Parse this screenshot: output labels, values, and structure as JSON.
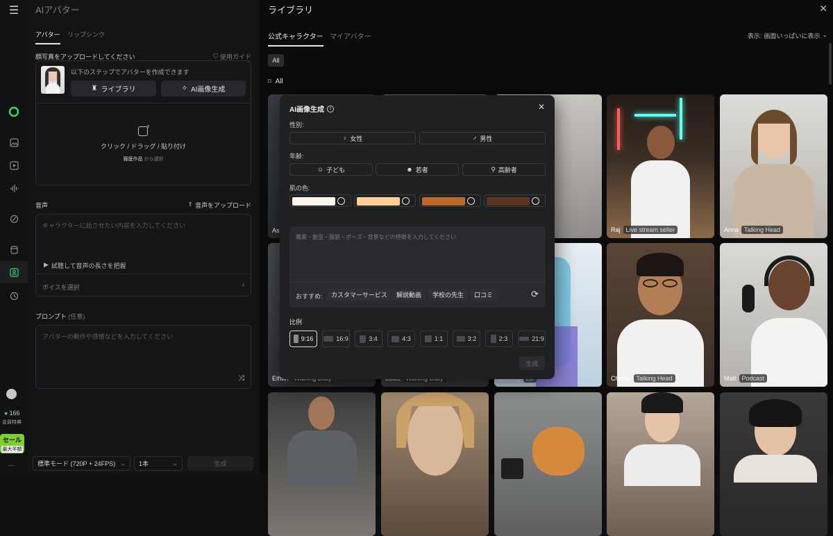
{
  "rail": {
    "icons": [
      "menu-icon",
      "logo-icon",
      "image-icon",
      "video-icon",
      "audio-icon",
      "edit-icon",
      "package-icon",
      "avatar-icon",
      "history-icon"
    ],
    "credits": "166",
    "member_label": "会員特典",
    "sale_label": "セール",
    "sale_sub": "最大半額",
    "more": "..."
  },
  "left": {
    "title": "AIアバター",
    "tabs": [
      "アバター",
      "リップシンク"
    ],
    "upload_heading": "顔写真をアップロードしてください",
    "guide_link": "使用ガイド",
    "steps_text": "以下のステップでアバターを作成できます",
    "library_btn": "ライブラリ",
    "ai_gen_btn": "AI画像生成",
    "drop_text": "クリック / ドラッグ / 貼り付け",
    "history_link": "履歴作品",
    "history_suffix": "から選択",
    "audio_heading": "音声",
    "audio_upload": "音声をアップロード",
    "script_placeholder": "キャラクターに話させたい内容を入力してください",
    "trial_text": "試聴して音声の長さを把握",
    "voice_select": "ボイスを選択",
    "prompt_heading": "プロンプト",
    "prompt_optional": "(任意)",
    "prompt_placeholder": "アバターの動作や感情などを入力してください",
    "mode_select": "標準モード (720P + 24FPS)",
    "count_select": "1本",
    "generate_btn": "生成"
  },
  "library": {
    "title": "ライブラリ",
    "tabs": [
      "公式キャラクター",
      "マイアバター"
    ],
    "display_label": "表示:",
    "display_value": "画面いっぱいに表示",
    "filter_all": "All",
    "section_all": "All",
    "cards": [
      {
        "name": "Ash",
        "tag": ""
      },
      {
        "name": "",
        "tag": ""
      },
      {
        "name": "",
        "tag": ""
      },
      {
        "name": "Raj",
        "tag": "Live stream seller"
      },
      {
        "name": "Arina",
        "tag": "Talking Head"
      },
      {
        "name": "Ethan",
        "tag": "Walking Daily"
      },
      {
        "name": "Louis",
        "tag": "Walking Daily"
      },
      {
        "name": "Dorothy",
        "tag": "2D"
      },
      {
        "name": "Charlie",
        "tag": "Talking Head"
      },
      {
        "name": "Matt",
        "tag": "Podcast"
      },
      {
        "name": "",
        "tag": ""
      },
      {
        "name": "",
        "tag": ""
      },
      {
        "name": "",
        "tag": ""
      },
      {
        "name": "",
        "tag": ""
      },
      {
        "name": "",
        "tag": ""
      }
    ]
  },
  "modal": {
    "title": "AI画像生成",
    "gender_label": "性別:",
    "gender": [
      "女性",
      "男性"
    ],
    "age_label": "年齢:",
    "age": [
      "子ども",
      "若者",
      "高齢者"
    ],
    "skin_label": "肌の色:",
    "skin_colors": [
      "#fff5ec",
      "#ffcf96",
      "#b8692c",
      "#5a3520"
    ],
    "desc_placeholder": "職業・髪型・服装・ポーズ・背景などの特徴を入力してください",
    "suggest_label": "おすすめ:",
    "suggestions": [
      "カスタマーサービス",
      "解説動画",
      "学校の先生",
      "口コミ"
    ],
    "ratio_label": "比例",
    "ratios": [
      "9:16",
      "16:9",
      "3:4",
      "4:3",
      "1:1",
      "3:2",
      "2:3",
      "21:9"
    ],
    "generate_btn": "生成"
  }
}
